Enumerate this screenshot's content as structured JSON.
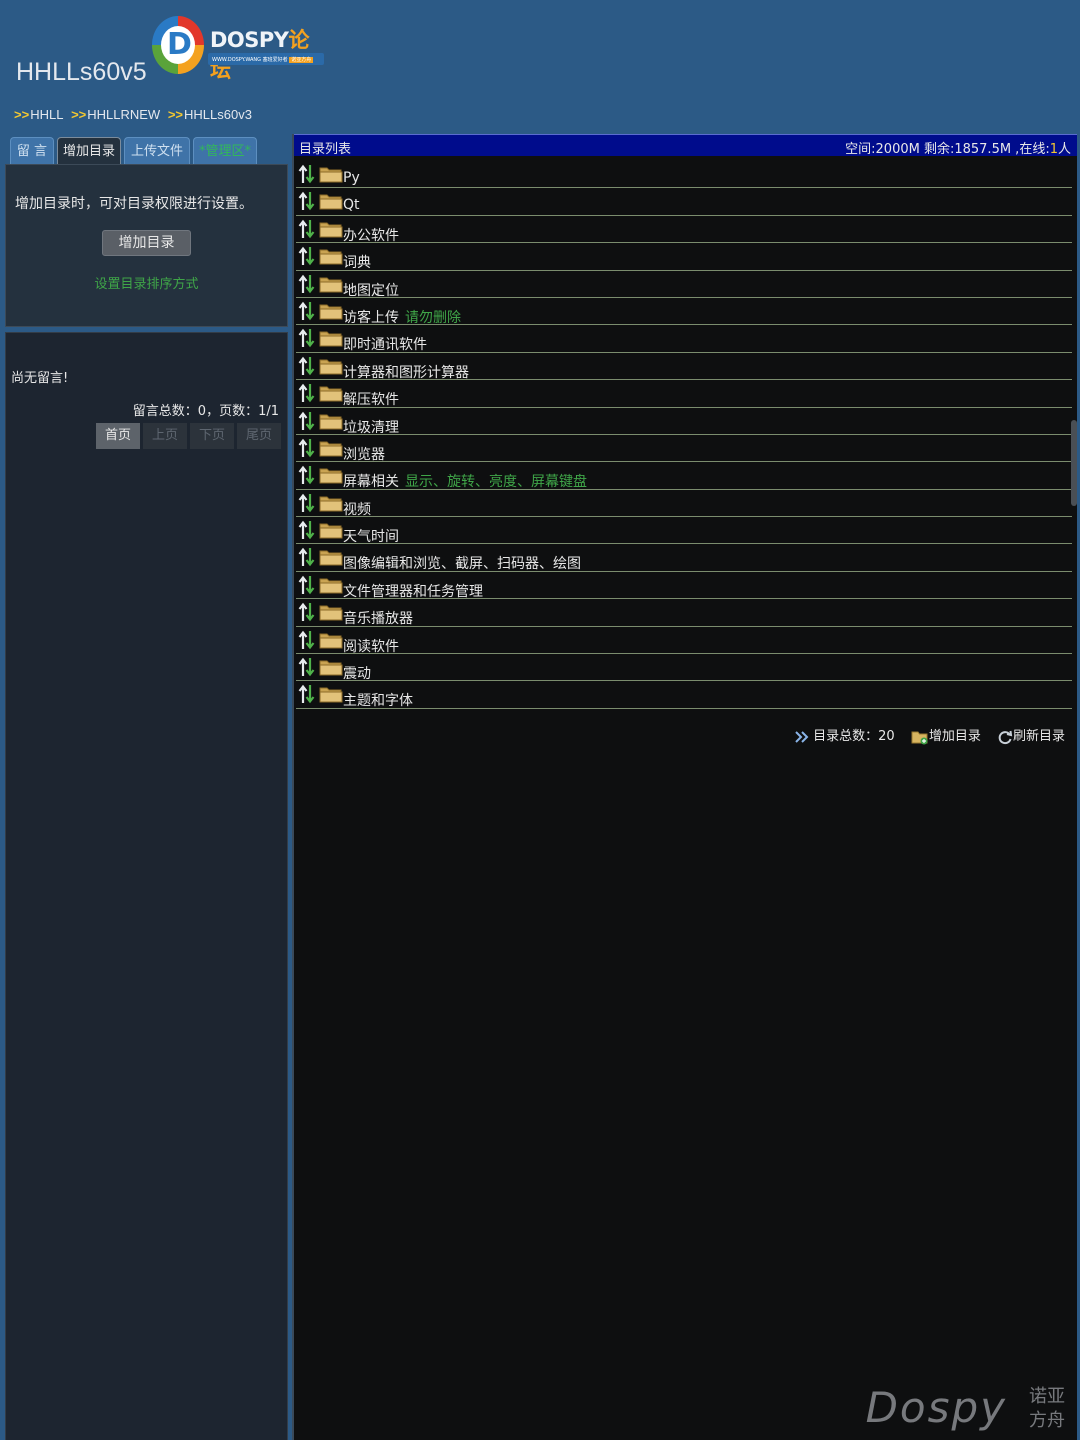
{
  "header": {
    "site_title": "HHLLs60v5",
    "logo": {
      "brand_main": "DOSPY",
      "brand_accent": "论坛",
      "sub_url": "WWW.DOSPY.WANG",
      "sub_text": "塞班爱好者",
      "sub_tag": "诺亚方舟"
    },
    "breadcrumb": [
      {
        "sep": ">>",
        "label": "HHLL"
      },
      {
        "sep": ">>",
        "label": "HHLLRNEW"
      },
      {
        "sep": ">>",
        "label": "HHLLs60v3"
      }
    ]
  },
  "left": {
    "tabs": [
      {
        "label": "留 言",
        "active": false
      },
      {
        "label": "增加目录",
        "active": true
      },
      {
        "label": "上传文件",
        "active": false
      },
      {
        "label": "*管理区*",
        "active": false
      }
    ],
    "add_panel": {
      "hint": "增加目录时，可对目录权限进行设置。",
      "button": "增加目录",
      "sort_link": "设置目录排序方式"
    },
    "messages": {
      "empty": "尚无留言!",
      "stats": "留言总数：0，页数：1/1",
      "pager": [
        "首页",
        "上页",
        "下页",
        "尾页"
      ]
    }
  },
  "right": {
    "header_title": "目录列表",
    "header_stats": "空间:2000M 剩余:1857.5M ,在线:",
    "online_count": "1",
    "online_unit": "人",
    "directories": [
      {
        "name": "Py",
        "note": ""
      },
      {
        "name": "Qt",
        "note": ""
      },
      {
        "name": "办公软件",
        "note": ""
      },
      {
        "name": "词典",
        "note": ""
      },
      {
        "name": "地图定位",
        "note": ""
      },
      {
        "name": "访客上传",
        "note": "请勿删除"
      },
      {
        "name": "即时通讯软件",
        "note": ""
      },
      {
        "name": "计算器和图形计算器",
        "note": ""
      },
      {
        "name": "解压软件",
        "note": ""
      },
      {
        "name": "垃圾清理",
        "note": ""
      },
      {
        "name": "浏览器",
        "note": ""
      },
      {
        "name": "屏幕相关",
        "note": "显示、旋转、亮度、屏幕键盘"
      },
      {
        "name": "视频",
        "note": ""
      },
      {
        "name": "天气时间",
        "note": ""
      },
      {
        "name": "图像编辑和浏览、截屏、扫码器、绘图",
        "note": ""
      },
      {
        "name": "文件管理器和任务管理",
        "note": ""
      },
      {
        "name": "音乐播放器",
        "note": ""
      },
      {
        "name": "阅读软件",
        "note": ""
      },
      {
        "name": "震动",
        "note": ""
      },
      {
        "name": "主题和字体",
        "note": ""
      }
    ],
    "footer": {
      "total": "目录总数：20",
      "add_dir": "增加目录",
      "refresh": "刷新目录"
    }
  },
  "watermark": {
    "brand": "Dospy",
    "line1": "诺亚",
    "line2": "方舟"
  },
  "colors": {
    "header_bg": "#2c5a86",
    "panel_bg": "#0e0f10",
    "list_header_bg": "#000c8c",
    "note_green": "#3fa548",
    "crumb_arrow": "#f4c830"
  },
  "icons": {
    "sort": "sort-arrows-icon",
    "folder": "folder-icon",
    "double_arrow": "double-arrow-icon",
    "add_folder": "add-folder-icon",
    "refresh": "refresh-icon"
  }
}
